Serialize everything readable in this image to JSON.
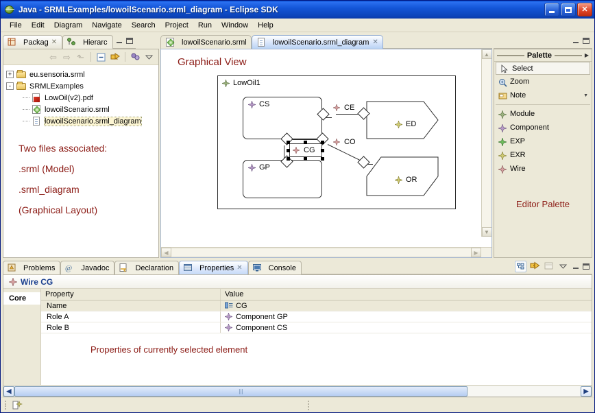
{
  "window": {
    "title": "Java - SRMLExamples/lowoilScenario.srml_diagram - Eclipse SDK",
    "app_icon": "eclipse-globe-icon",
    "minimize_label": "Minimize",
    "maximize_label": "Maximize",
    "close_label": "Close"
  },
  "menu": {
    "items": [
      {
        "label": "File"
      },
      {
        "label": "Edit"
      },
      {
        "label": "Diagram"
      },
      {
        "label": "Navigate"
      },
      {
        "label": "Search"
      },
      {
        "label": "Project"
      },
      {
        "label": "Run"
      },
      {
        "label": "Window"
      },
      {
        "label": "Help"
      }
    ]
  },
  "package_explorer": {
    "tabs": [
      {
        "label": "Packag",
        "icon": "package-explorer-icon",
        "active": true,
        "closable": true
      },
      {
        "label": "Hierarc",
        "icon": "type-hierarchy-icon",
        "active": false,
        "closable": false
      }
    ],
    "toolbar": [
      {
        "name": "back-icon",
        "label": "Back"
      },
      {
        "name": "forward-icon",
        "label": "Forward"
      },
      {
        "name": "up-icon",
        "label": "Up"
      },
      {
        "name": "collapse-all-icon",
        "label": "Collapse All"
      },
      {
        "name": "link-with-editor-icon",
        "label": "Link with Editor"
      },
      {
        "name": "view-filter-icon",
        "label": "Filters"
      },
      {
        "name": "view-menu-icon",
        "label": "View Menu"
      }
    ],
    "tree": [
      {
        "label": "eu.sensoria.srml",
        "icon": "folder-icon",
        "toggle": "+",
        "level": 0,
        "selected": false
      },
      {
        "label": "SRMLExamples",
        "icon": "folder-icon",
        "toggle": "-",
        "level": 0,
        "selected": false
      },
      {
        "label": "LowOil(v2).pdf",
        "icon": "pdf-icon",
        "toggle": "",
        "level": 1,
        "selected": false
      },
      {
        "label": "lowoilScenario.srml",
        "icon": "srml-model-icon",
        "toggle": "",
        "level": 1,
        "selected": false
      },
      {
        "label": "lowoilScenario.srml_diagram",
        "icon": "diagram-file-icon",
        "toggle": "",
        "level": 1,
        "selected": true
      }
    ],
    "annotation": [
      "Two files associated:",
      ".srml (Model)",
      ".srml_diagram",
      "(Graphical Layout)"
    ]
  },
  "editor": {
    "tabs": [
      {
        "label": "lowoilScenario.srml",
        "icon": "srml-model-icon",
        "active": false,
        "closable": false
      },
      {
        "label": "lowoilScenario.srml_diagram",
        "icon": "diagram-file-icon",
        "active": true,
        "closable": true
      }
    ],
    "canvas_title": "Graphical View",
    "diagram": {
      "container": {
        "label": "LowOil1",
        "icon": "module-star-icon"
      },
      "nodes": [
        {
          "id": "CS",
          "label": "CS",
          "shape": "rounded-rect",
          "icon": "component-star-icon"
        },
        {
          "id": "GP",
          "label": "GP",
          "shape": "rounded-rect",
          "icon": "component-star-icon"
        },
        {
          "id": "ED",
          "label": "ED",
          "shape": "pentagon",
          "icon": "exr-star-icon"
        },
        {
          "id": "OR",
          "label": "OR",
          "shape": "pentagon",
          "icon": "exr-star-icon"
        },
        {
          "id": "CG",
          "label": "CG",
          "shape": "wire-label",
          "icon": "wire-star-icon",
          "selected": true
        }
      ],
      "edge_labels": [
        {
          "id": "CE",
          "label": "CE",
          "icon": "wire-star-icon"
        },
        {
          "id": "CO",
          "label": "CO",
          "icon": "wire-star-icon"
        }
      ]
    }
  },
  "palette": {
    "header": "Palette",
    "tools": [
      {
        "label": "Select",
        "icon": "pointer-icon",
        "selected": true
      },
      {
        "label": "Zoom",
        "icon": "magnifier-icon",
        "selected": false
      },
      {
        "label": "Note",
        "icon": "note-icon",
        "selected": false,
        "has_menu": true
      }
    ],
    "elements": [
      {
        "label": "Module",
        "icon": "module-star-icon",
        "color": "#8fa878"
      },
      {
        "label": "Component",
        "icon": "component-star-icon",
        "color": "#a98fba"
      },
      {
        "label": "EXP",
        "icon": "exp-star-icon",
        "color": "#5faa55"
      },
      {
        "label": "EXR",
        "icon": "exr-star-icon",
        "color": "#c3bf60"
      },
      {
        "label": "Wire",
        "icon": "wire-star-icon",
        "color": "#c98d8d"
      }
    ],
    "annotation": "Editor Palette"
  },
  "bottom_panel": {
    "tabs": [
      {
        "label": "Problems",
        "icon": "problems-icon",
        "active": false,
        "closable": false
      },
      {
        "label": "Javadoc",
        "icon": "javadoc-icon",
        "active": false,
        "closable": false
      },
      {
        "label": "Declaration",
        "icon": "declaration-icon",
        "active": false,
        "closable": false
      },
      {
        "label": "Properties",
        "icon": "properties-icon",
        "active": true,
        "closable": true
      },
      {
        "label": "Console",
        "icon": "console-icon",
        "active": false,
        "closable": false
      }
    ],
    "toolbar": [
      {
        "name": "show-categories-icon",
        "label": "Show Categories"
      },
      {
        "name": "show-advanced-icon",
        "label": "Show Advanced Properties"
      },
      {
        "name": "restore-defaults-icon",
        "label": "Restore Default Value"
      },
      {
        "name": "view-menu-icon",
        "label": "View Menu"
      }
    ],
    "properties": {
      "title": "Wire CG",
      "title_icon": "wire-star-icon",
      "side_tabs": [
        {
          "label": "Core",
          "active": true
        }
      ],
      "columns": [
        "Property",
        "Value"
      ],
      "rows": [
        {
          "property": "Name",
          "value": "CG",
          "icon": "text-field-icon",
          "selected": true
        },
        {
          "property": "Role A",
          "value": "Component GP",
          "icon": "component-star-icon",
          "selected": false
        },
        {
          "property": "Role B",
          "value": "Component CS",
          "icon": "component-star-icon",
          "selected": false
        }
      ],
      "annotation": "Properties of currently selected element"
    }
  },
  "statusbar": {
    "icon": "writable-indicator-icon"
  },
  "colors": {
    "title_blue": "#1456d8",
    "annotation_red": "#8b1a14",
    "panel_bg": "#ece9d8",
    "prop_title_blue": "#1a3f8f",
    "scroll_thumb_blue": "#b6cdf2"
  }
}
